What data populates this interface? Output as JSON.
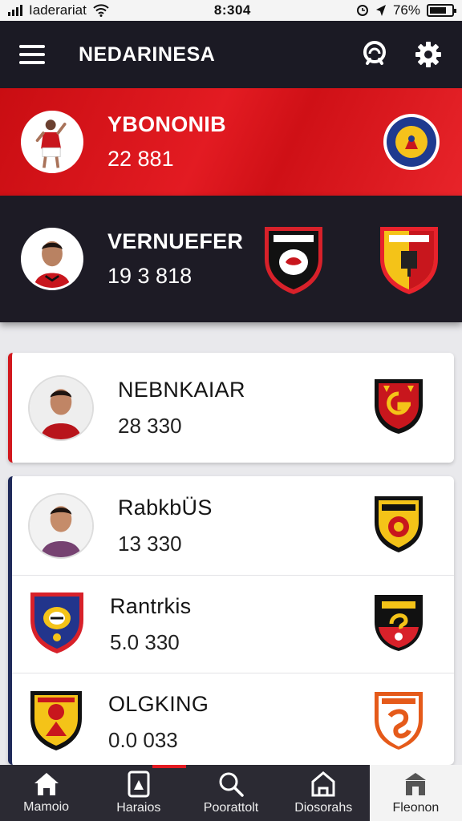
{
  "status_bar": {
    "carrier": "Iaderariat",
    "time": "8:304",
    "battery": "76%"
  },
  "header": {
    "title": "NEDARINESA",
    "icons": [
      "menu-icon",
      "search-icon",
      "gear-icon"
    ]
  },
  "featured": [
    {
      "name": "YBONONIB",
      "score": "22 881"
    },
    {
      "name": "VERNUEFER",
      "score": "19 3 818"
    }
  ],
  "list": [
    {
      "name": "NEBNKAIAR",
      "score": "28 330"
    },
    {
      "name": "RabkbÜS",
      "score": "13 330"
    },
    {
      "name": "Rantrkis",
      "score": "5.0 330"
    },
    {
      "name": "OLGKING",
      "score": "0.0 033"
    }
  ],
  "bottom_nav": [
    {
      "label": "Mamoio",
      "icon": "home-icon"
    },
    {
      "label": "Haraios",
      "icon": "card-icon"
    },
    {
      "label": "Poorattolt",
      "icon": "search-icon"
    },
    {
      "label": "Diosorahs",
      "icon": "shop-icon"
    },
    {
      "label": "Fleonon",
      "icon": "store-icon"
    }
  ],
  "colors": {
    "accent_red": "#e31b22",
    "header_dark": "#1b1a24",
    "navy": "#1f2a5a"
  }
}
